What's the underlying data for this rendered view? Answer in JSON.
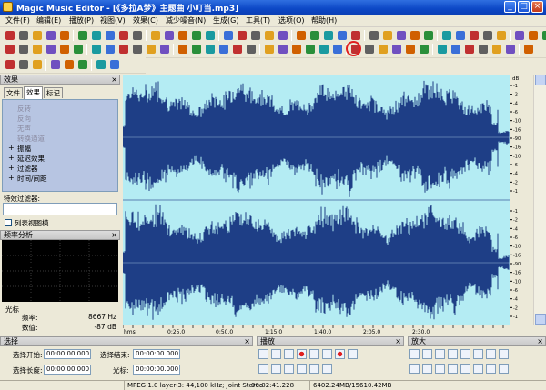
{
  "window": {
    "title": "Magic Music Editor - [《多拉A梦》主题曲 小叮当.mp3]",
    "min": "_",
    "max": "□",
    "close": "×"
  },
  "menu": [
    "文件(F)",
    "编辑(E)",
    "播放(P)",
    "视图(V)",
    "效果(C)",
    "减少噪音(N)",
    "生成(G)",
    "工具(T)",
    "选项(O)",
    "帮助(H)"
  ],
  "effects_panel": {
    "title": "效果",
    "close": "×",
    "tabs": [
      "文件",
      "效果",
      "标记"
    ],
    "items": [
      {
        "label": "反转",
        "disabled": true,
        "bullet": ""
      },
      {
        "label": "反向",
        "disabled": true,
        "bullet": ""
      },
      {
        "label": "无声",
        "disabled": true,
        "bullet": ""
      },
      {
        "label": "转换通道",
        "disabled": true,
        "bullet": ""
      },
      {
        "label": "振幅",
        "disabled": false,
        "bullet": "+"
      },
      {
        "label": "延迟效果",
        "disabled": false,
        "bullet": "+"
      },
      {
        "label": "过滤器",
        "disabled": false,
        "bullet": "+"
      },
      {
        "label": "时间/间距",
        "disabled": false,
        "bullet": "+"
      }
    ],
    "filter_label": "特效过滤器:",
    "filter_value": "",
    "tree_view_label": "列表视图模"
  },
  "freq_panel": {
    "title": "频率分析",
    "close": "×",
    "cursor_label": "光标",
    "freq_label": "频率:",
    "freq_value": "8667 Hz",
    "value_label": "数值:",
    "value_value": "-87 dB"
  },
  "db_ruler": {
    "unit": "dB",
    "ticks_top": [
      "-1",
      "-2",
      "-4",
      "-6",
      "-10",
      "-16",
      "-90",
      "-16",
      "-10",
      "-6",
      "-4",
      "-2",
      "-1"
    ],
    "ticks_bottom": [
      "-1",
      "-2",
      "-4",
      "-6",
      "-10",
      "-16",
      "-90",
      "-16",
      "-10",
      "-6",
      "-4",
      "-2",
      "-1"
    ]
  },
  "timeline": {
    "labels": [
      "hms",
      "0:25.0",
      "0:50.0",
      "1:15.0",
      "1:40.0",
      "2:05.0",
      "2:30.0"
    ]
  },
  "selection_panel": {
    "title": "选择",
    "close": "×",
    "start_label": "选择开始:",
    "start_value": "00:00:00.000",
    "length_label": "选择长度:",
    "length_value": "00:00:00.000",
    "end_label": "选择结束:",
    "end_value": "00:00:00.000",
    "cursor_label": "光标:",
    "cursor_value": "00:00:00.000"
  },
  "play_panel": {
    "title": "播放",
    "close": "×"
  },
  "zoom_panel": {
    "title": "放大",
    "close": "×"
  },
  "status": [
    "MPEG 1.0 layer-3: 44,100 kHz; Joint Stereo",
    "00:02:41.228",
    "6402.24MB/15610.42MB"
  ],
  "colors": {
    "wave_bg": "#b4ecf3",
    "wave": "#1e3e86",
    "title_blue": "#0c48c6"
  }
}
